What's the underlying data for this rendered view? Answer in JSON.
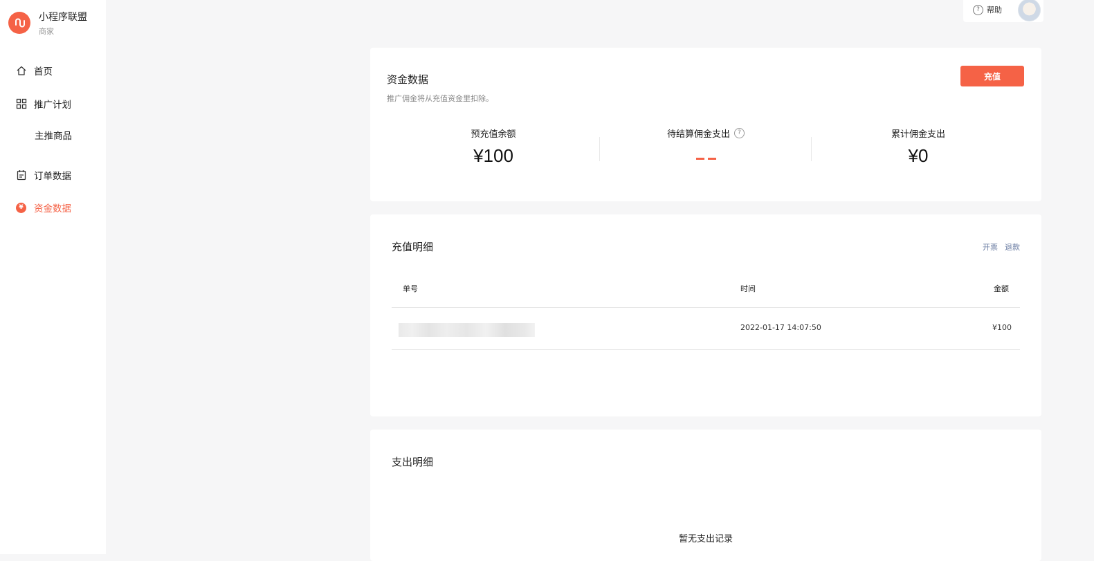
{
  "brand": {
    "title": "小程序联盟",
    "subtitle": "商家"
  },
  "sidebar": {
    "items": [
      {
        "label": "首页",
        "icon": "home-icon"
      },
      {
        "label": "推广计划",
        "icon": "grid-icon"
      },
      {
        "label": "主推商品",
        "icon": ""
      },
      {
        "label": "订单数据",
        "icon": "clipboard-icon"
      },
      {
        "label": "资金数据",
        "icon": "yen-coin-icon",
        "active": true
      }
    ]
  },
  "topbar": {
    "help_label": "帮助"
  },
  "funds": {
    "title": "资金数据",
    "desc": "推广佣金将从充值资金里扣除。",
    "recharge_label": "充值",
    "stats": [
      {
        "label": "预充值余额",
        "value": "¥100"
      },
      {
        "label": "待结算佣金支出",
        "value": "--"
      },
      {
        "label": "累计佣金支出",
        "value": "¥0"
      }
    ]
  },
  "recharge_detail": {
    "title": "充值明细",
    "links": {
      "invoice": "开票",
      "refund": "退款"
    },
    "columns": [
      "单号",
      "时间",
      "金额"
    ],
    "rows": [
      {
        "order_no": "",
        "time": "2022-01-17 14:07:50",
        "amount": "¥100"
      }
    ]
  },
  "expense_detail": {
    "title": "支出明细",
    "empty_text": "暂无支出记录"
  },
  "colors": {
    "accent": "#f56246",
    "link": "#6b7da3",
    "background": "#f6f6f7"
  }
}
